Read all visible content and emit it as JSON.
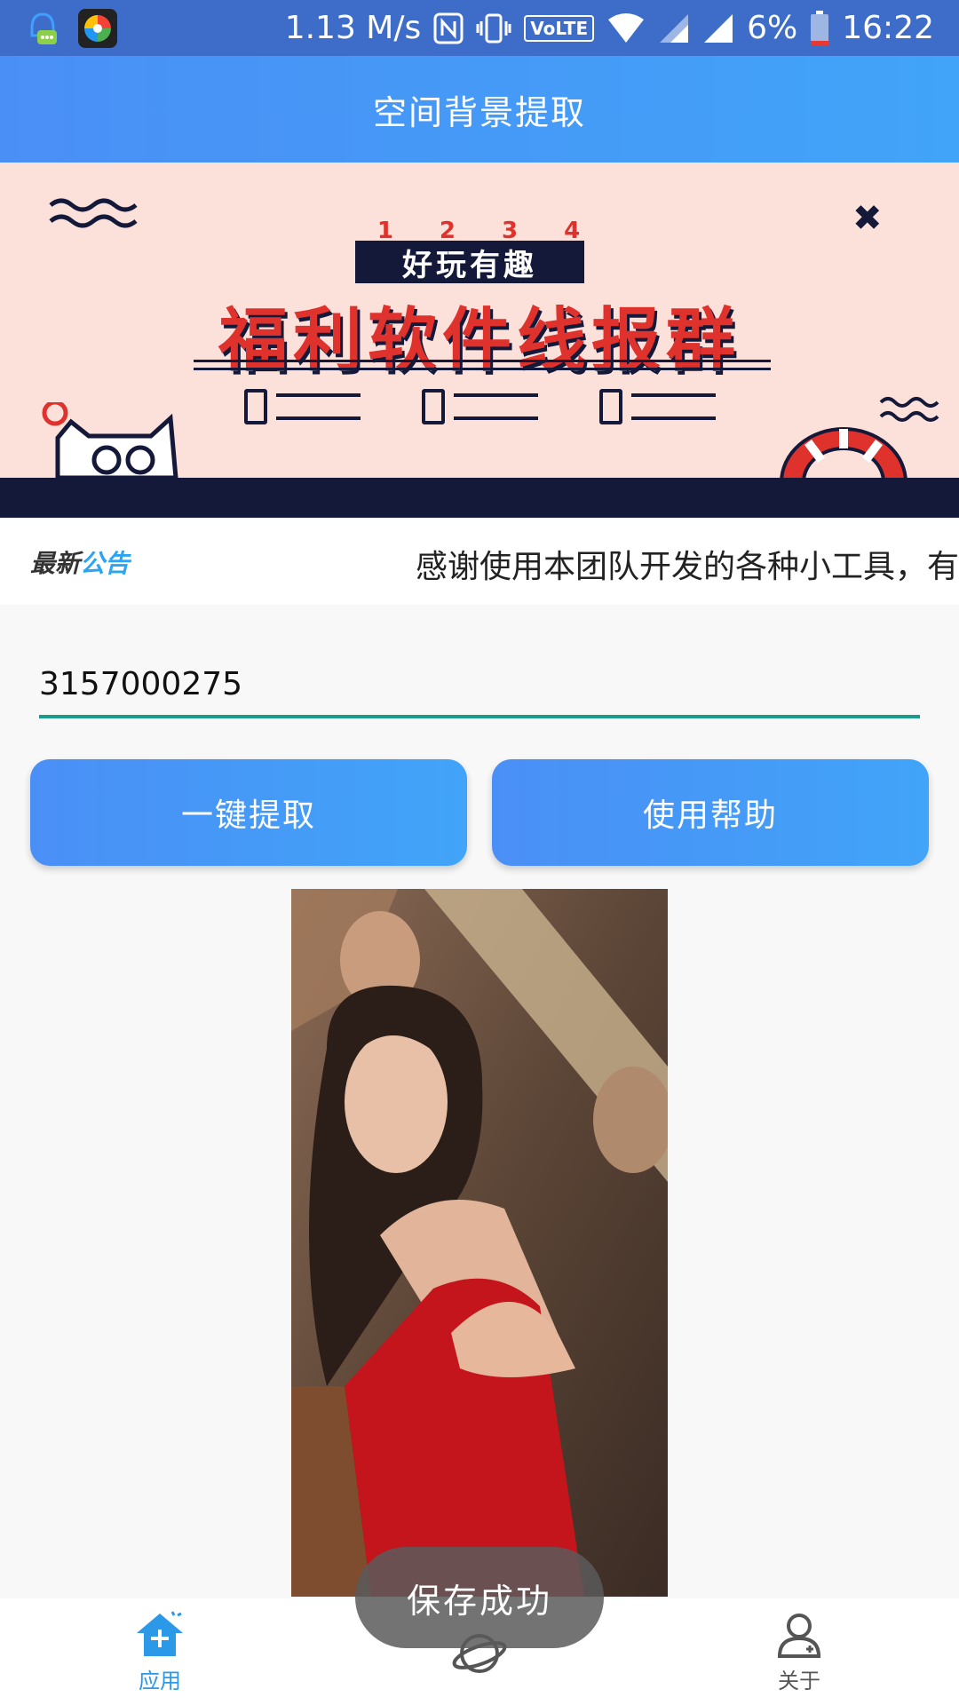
{
  "status_bar": {
    "network_speed": "1.13 M/s",
    "volte": "VoLTE",
    "battery": "6%",
    "time": "16:22"
  },
  "header": {
    "title": "空间背景提取"
  },
  "banner": {
    "numbers": "1234",
    "tag": "好玩有趣",
    "title": "福利软件线报群"
  },
  "notice": {
    "logo_part1": "最新",
    "logo_part2": "公告",
    "text": "感谢使用本团队开发的各种小工具，有"
  },
  "input": {
    "value": "3157000275"
  },
  "buttons": {
    "extract": "一键提取",
    "help": "使用帮助"
  },
  "toast": {
    "text": "保存成功"
  },
  "bottom_nav": {
    "apps": "应用",
    "about": "关于"
  },
  "colors": {
    "status_bar": "#3d6dc9",
    "header_start": "#4a8ff6",
    "header_end": "#41a4f8",
    "banner_bg": "#fce1db",
    "banner_red": "#e0322c",
    "banner_navy": "#14193a",
    "input_underline": "#1a9b8c",
    "nav_active": "#2c98e8"
  }
}
